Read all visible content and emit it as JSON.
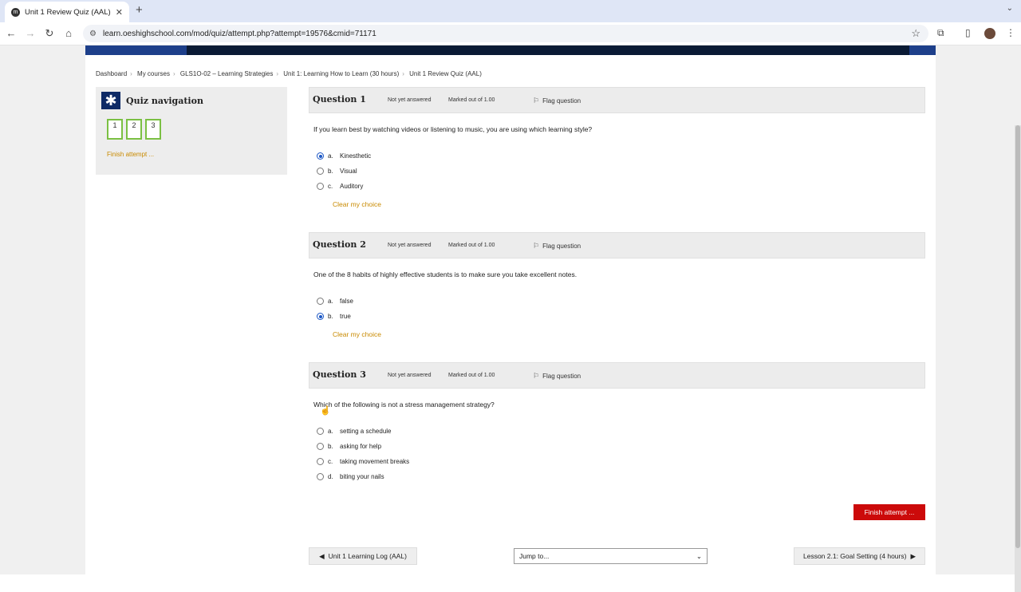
{
  "browser": {
    "tab_title": "Unit 1 Review Quiz (AAL)",
    "tab_favicon": "m",
    "url": "learn.oeshighschool.com/mod/quiz/attempt.php?attempt=19576&cmid=71171"
  },
  "breadcrumbs": [
    "Dashboard",
    "My courses",
    "GLS1O-02 – Learning Strategies",
    "Unit 1: Learning How to Learn (30 hours)",
    "Unit 1 Review Quiz (AAL)"
  ],
  "quiz_nav": {
    "title": "Quiz navigation",
    "buttons": [
      "1",
      "2",
      "3"
    ],
    "finish_link": "Finish attempt ..."
  },
  "questions": [
    {
      "label": "Question 1",
      "state": "Not yet answered",
      "mark": "Marked out of 1.00",
      "flag": "Flag question",
      "text": "If you learn best by watching videos or listening to music, you are using which learning style?",
      "answers": [
        {
          "letter": "a.",
          "text": "Kinesthetic",
          "selected": true
        },
        {
          "letter": "b.",
          "text": "Visual",
          "selected": false
        },
        {
          "letter": "c.",
          "text": "Auditory",
          "selected": false
        }
      ],
      "clear": "Clear my choice"
    },
    {
      "label": "Question 2",
      "state": "Not yet answered",
      "mark": "Marked out of 1.00",
      "flag": "Flag question",
      "text": "One of the 8 habits of highly effective students is to make sure you take excellent notes.",
      "answers": [
        {
          "letter": "a.",
          "text": "false",
          "selected": false
        },
        {
          "letter": "b.",
          "text": "true",
          "selected": true
        }
      ],
      "clear": "Clear my choice"
    },
    {
      "label": "Question 3",
      "state": "Not yet answered",
      "mark": "Marked out of 1.00",
      "flag": "Flag question",
      "text": "Which of the following is not a stress management strategy?",
      "answers": [
        {
          "letter": "a.",
          "text": "setting a schedule",
          "selected": false
        },
        {
          "letter": "b.",
          "text": "asking for help",
          "selected": false
        },
        {
          "letter": "c.",
          "text": "taking movement breaks",
          "selected": false
        },
        {
          "letter": "d.",
          "text": "biting your nails",
          "selected": false
        }
      ],
      "clear": ""
    }
  ],
  "finish_button": "Finish attempt ...",
  "footer": {
    "prev": "Unit 1 Learning Log (AAL)",
    "jump": "Jump to...",
    "next": "Lesson 2.1: Goal Setting (4 hours)"
  },
  "colors": {
    "accent": "#c98a00",
    "finish": "#cc0a0a",
    "nav": "#0e2a66",
    "radio": "#1a56c5"
  }
}
